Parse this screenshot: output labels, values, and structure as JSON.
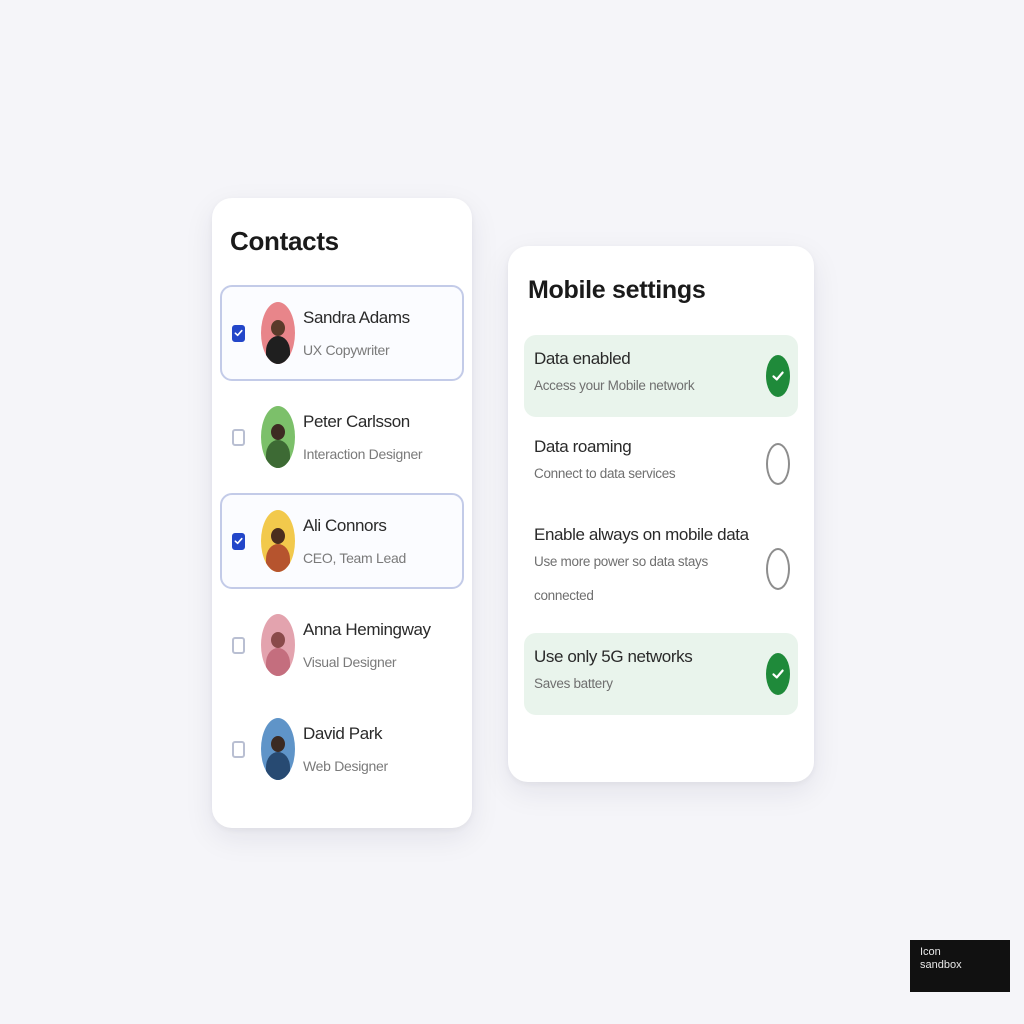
{
  "contacts": {
    "title": "Contacts",
    "items": [
      {
        "name": "Sandra Adams",
        "role": "UX Copywriter",
        "checked": true,
        "avatar_bg": "#e8858a",
        "avatar_head": "#5a3a2a",
        "avatar_body": "#1f1f1f"
      },
      {
        "name": "Peter Carlsson",
        "role": "Interaction Designer",
        "checked": false,
        "avatar_bg": "#7cc06a",
        "avatar_head": "#3d2a22",
        "avatar_body": "#3d6a34"
      },
      {
        "name": "Ali Connors",
        "role": "CEO, Team Lead",
        "checked": true,
        "avatar_bg": "#f2c94c",
        "avatar_head": "#4a2e1e",
        "avatar_body": "#b6542e"
      },
      {
        "name": "Anna Hemingway",
        "role": "Visual Designer",
        "checked": false,
        "avatar_bg": "#e3a3ae",
        "avatar_head": "#8a4a4a",
        "avatar_body": "#c46e7e"
      },
      {
        "name": "David Park",
        "role": "Web Designer",
        "checked": false,
        "avatar_bg": "#5f94c8",
        "avatar_head": "#3b2a22",
        "avatar_body": "#274a72"
      }
    ]
  },
  "settings": {
    "title": "Mobile settings",
    "items": [
      {
        "title": "Data enabled",
        "desc": "Access your Mobile network",
        "on": true
      },
      {
        "title": "Data roaming",
        "desc": "Connect to data services",
        "on": false
      },
      {
        "title": "Enable always on mobile data",
        "desc": "Use more power so data stays connected",
        "on": false
      },
      {
        "title": "Use only 5G networks",
        "desc": "Saves battery",
        "on": true
      }
    ]
  },
  "badge": {
    "line1": "Icon",
    "line2": "sandbox"
  },
  "colors": {
    "accent_blue": "#2346c9",
    "accent_green": "#1f8a3a",
    "selected_border": "#c3cbe8",
    "on_bg": "#e9f4ec"
  }
}
